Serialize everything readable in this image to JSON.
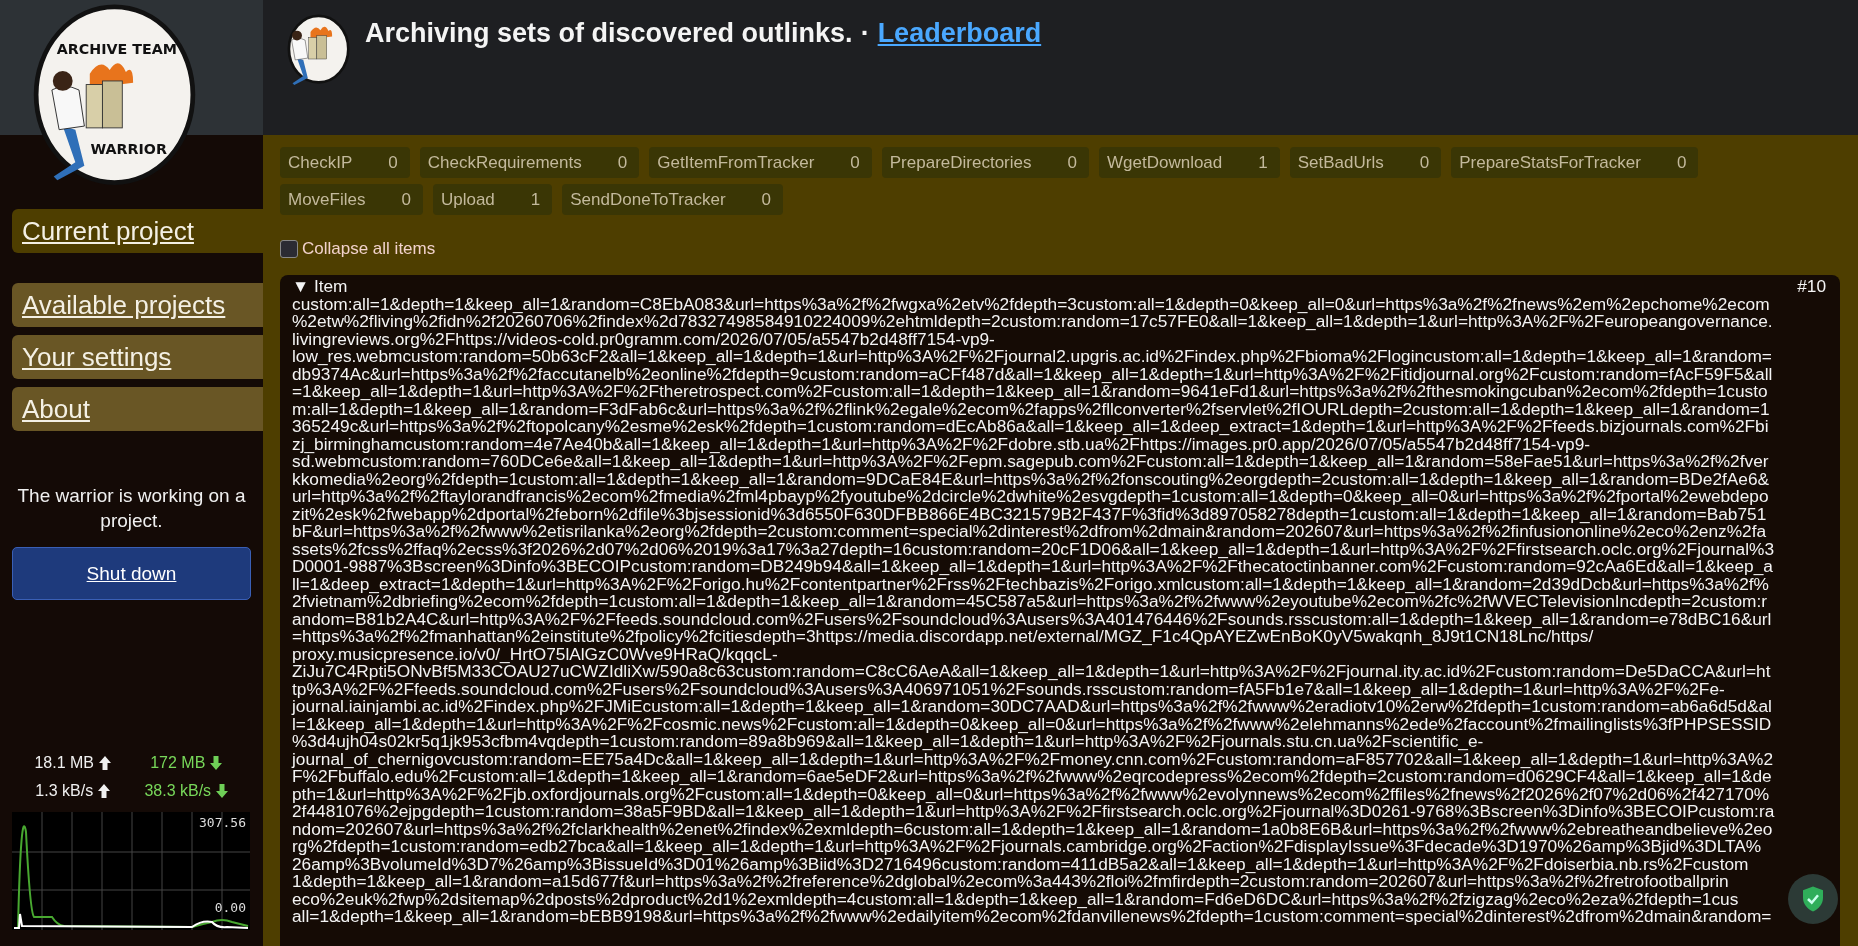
{
  "sidebar": {
    "logo_text": [
      "ARCHIVE TEAM",
      "WARRIOR"
    ],
    "nav": [
      {
        "label": "Current project",
        "selected": true
      },
      {
        "label": "Available projects",
        "selected": false
      },
      {
        "label": "Your settings",
        "selected": false
      },
      {
        "label": "About",
        "selected": false
      }
    ],
    "status": "The warrior is working on a project.",
    "shutdown_button": "Shut down",
    "stats": {
      "uploaded": "18.1 MB",
      "downloaded": "172 MB",
      "upload_rate": "1.3 kB/s",
      "download_rate": "38.3 kB/s"
    },
    "graph": {
      "max_label": "307.56",
      "min_label": "0.00"
    }
  },
  "header": {
    "title": "Archiving sets of discovered outlinks.",
    "separator": "·",
    "link": "Leaderboard"
  },
  "tasks": [
    {
      "name": "CheckIP",
      "count": "0"
    },
    {
      "name": "CheckRequirements",
      "count": "0"
    },
    {
      "name": "GetItemFromTracker",
      "count": "0"
    },
    {
      "name": "PrepareDirectories",
      "count": "0"
    },
    {
      "name": "WgetDownload",
      "count": "1"
    },
    {
      "name": "SetBadUrls",
      "count": "0"
    },
    {
      "name": "PrepareStatsForTracker",
      "count": "0"
    },
    {
      "name": "MoveFiles",
      "count": "0"
    },
    {
      "name": "Upload",
      "count": "1"
    },
    {
      "name": "SendDoneToTracker",
      "count": "0"
    }
  ],
  "collapse_all": {
    "label": "Collapse all items",
    "checked": false
  },
  "item": {
    "toggle": "▼",
    "title": "Item",
    "number": "#10",
    "lines": [
      "custom:all=1&depth=1&keep_all=1&random=C8EbA083&url=https%3a%2f%2fwgxa%2etv%2fdepth=3custom:all=1&depth=0&keep_all=0&url=https%3a%2f%2fnews%2em%2epchome%2ecom",
      "%2etw%2fliving%2fidn%2f20260706%2findex%2d78327498584910224009%2ehtmldepth=2custom:random=17c57FE0&all=1&keep_all=1&depth=1&url=http%3A%2F%2Feuropeangovernance.",
      "livingreviews.org%2Fhttps://videos-cold.pr0gramm.com/2026/07/05/a5547b2d48ff7154-vp9-",
      "low_res.webmcustom:random=50b63cF2&all=1&keep_all=1&depth=1&url=http%3A%2F%2Fjournal2.upgris.ac.id%2Findex.php%2Fbioma%2Flogincustom:all=1&depth=1&keep_all=1&random=",
      "db9374Ac&url=https%3a%2f%2faccutanelb%2eonline%2fdepth=9custom:random=aCFf487d&all=1&keep_all=1&depth=1&url=http%3A%2F%2Fitidjournal.org%2Fcustom:random=fAcF59F5&all",
      "=1&keep_all=1&depth=1&url=http%3A%2F%2Ftheretrospect.com%2Fcustom:all=1&depth=1&keep_all=1&random=9641eFd1&url=https%3a%2f%2fthesmokingcuban%2ecom%2fdepth=1custo",
      "m:all=1&depth=1&keep_all=1&random=F3dFab6c&url=https%3a%2f%2flink%2egale%2ecom%2fapps%2fllconverter%2fservlet%2fIOURLdepth=2custom:all=1&depth=1&keep_all=1&random=1",
      "365249c&url=https%3a%2f%2ftopolcany%2esme%2esk%2fdepth=1custom:random=dEcAb86a&all=1&keep_all=1&deep_extract=1&depth=1&url=http%3A%2F%2Ffeeds.bizjournals.com%2Fbi",
      "zj_birminghamcustom:random=4e7Ae40b&all=1&keep_all=1&depth=1&url=http%3A%2F%2Fdobre.stb.ua%2Fhttps://images.pr0.app/2026/07/05/a5547b2d48ff7154-vp9-",
      "sd.webmcustom:random=760DCe6e&all=1&keep_all=1&depth=1&url=http%3A%2F%2Fepm.sagepub.com%2Fcustom:all=1&depth=1&keep_all=1&random=58eFae51&url=https%3a%2f%2fver",
      "kkomedia%2eorg%2fdepth=1custom:all=1&depth=1&keep_all=1&random=9DCaE84E&url=https%3a%2f%2fonscouting%2eorgdepth=2custom:all=1&depth=1&keep_all=1&random=BDe2fAe6&",
      "url=http%3a%2f%2ftaylorandfrancis%2ecom%2fmedia%2fml4pbayp%2fyoutube%2dcircle%2dwhite%2esvgdepth=1custom:all=1&depth=0&keep_all=0&url=https%3a%2f%2fportal%2ewebdepo",
      "zit%2esk%2fwebapp%2dportal%2feborn%2dfile%3bjsessionid%3d6550F630DFBB866E4BC321579B2F437F%3fid%3d897058278depth=1custom:all=1&depth=1&keep_all=1&random=Bab751",
      "bF&url=https%3a%2f%2fwww%2etisrilanka%2eorg%2fdepth=2custom:comment=special%2dinterest%2dfrom%2dmain&random=202607&url=https%3a%2f%2finfusiononline%2eco%2enz%2fa",
      "ssets%2fcss%2ffaq%2ecss%3f2026%2d07%2d06%2019%3a17%3a27depth=16custom:random=20cF1D06&all=1&keep_all=1&depth=1&url=http%3A%2F%2Ffirstsearch.oclc.org%2Fjournal%3",
      "D0001-9887%3Bscreen%3Dinfo%3BECOIPcustom:random=DB249b94&all=1&keep_all=1&depth=1&url=http%3A%2F%2Fthecatoctinbanner.com%2Fcustom:random=92cAa6Ed&all=1&keep_a",
      "ll=1&deep_extract=1&depth=1&url=http%3A%2F%2Forigo.hu%2Fcontentpartner%2Frss%2Ftechbazis%2Forigo.xmlcustom:all=1&depth=1&keep_all=1&random=2d39dDcb&url=https%3a%2f%",
      "2fvietnam%2dbriefing%2ecom%2fdepth=1custom:all=1&depth=1&keep_all=1&random=45C587a5&url=https%3a%2f%2fwww%2eyoutube%2ecom%2fc%2fWVECTelevisionIncdepth=2custom:r",
      "andom=B81b2A4C&url=http%3A%2F%2Ffeeds.soundcloud.com%2Fusers%2Fsoundcloud%3Ausers%3A401476446%2Fsounds.rsscustom:all=1&depth=1&keep_all=1&random=e78dBC16&url",
      "=https%3a%2f%2fmanhattan%2einstitute%2fpolicy%2fcitiesdepth=3https://media.discordapp.net/external/MGZ_F1c4QpAYEZwEnBoK0yV5wakqnh_8J9t1CN18Lnc/https/",
      "proxy.musicpresence.io/v0/_HrtO75lAlGzC0Wve9HRaQ/kqqcL-",
      "ZiJu7C4Rpti5ONvBf5M33COAU27uCWZIdliXw/590a8c63custom:random=C8cC6AeA&all=1&keep_all=1&depth=1&url=http%3A%2F%2Fjournal.ity.ac.id%2Fcustom:random=De5DaCCA&url=ht",
      "tp%3A%2F%2Ffeeds.soundcloud.com%2Fusers%2Fsoundcloud%3Ausers%3A406971051%2Fsounds.rsscustom:random=fA5Fb1e7&all=1&keep_all=1&depth=1&url=http%3A%2F%2Fe-",
      "journal.iainjambi.ac.id%2Findex.php%2FJMiEcustom:all=1&depth=1&keep_all=1&random=30DC7AAD&url=https%3a%2f%2fwww%2eradiotv10%2erw%2fdepth=1custom:random=ab6a6d5d&al",
      "l=1&keep_all=1&depth=1&url=http%3A%2F%2Fcosmic.news%2Fcustom:all=1&depth=0&keep_all=0&url=https%3a%2f%2fwww%2elehmanns%2ede%2faccount%2fmailinglists%3fPHPSESSID",
      "%3d4ujh04s02kr5q1jk953cfbm4vqdepth=1custom:random=89a8b969&all=1&keep_all=1&depth=1&url=http%3A%2F%2Fjournals.stu.cn.ua%2Fscientific_e-",
      "journal_of_chernigovcustom:random=EE75a4Dc&all=1&keep_all=1&depth=1&url=http%3A%2F%2Fmoney.cnn.com%2Fcustom:random=aF857702&all=1&keep_all=1&depth=1&url=http%3A%2",
      "F%2Fbuffalo.edu%2Fcustom:all=1&depth=1&keep_all=1&random=6ae5eDF2&url=https%3a%2f%2fwww%2eqrcodepress%2ecom%2fdepth=2custom:random=d0629CF4&all=1&keep_all=1&de",
      "pth=1&url=http%3A%2F%2Fjb.oxfordjournals.org%2Fcustom:all=1&depth=0&keep_all=0&url=https%3a%2f%2fwww%2evolynnews%2ecom%2ffiles%2fnews%2f2026%2f07%2d06%2f427170%",
      "2f4481076%2ejpgdepth=1custom:random=38a5F9BD&all=1&keep_all=1&depth=1&url=http%3A%2F%2Ffirstsearch.oclc.org%2Fjournal%3D0261-9768%3Bscreen%3Dinfo%3BECOIPcustom:ra",
      "ndom=202607&url=https%3a%2f%2fclarkhealth%2enet%2findex%2exmldepth=6custom:all=1&depth=1&keep_all=1&random=1a0b8E6B&url=https%3a%2f%2fwww%2ebreatheandbelieve%2eo",
      "rg%2fdepth=1custom:random=edb27bca&all=1&keep_all=1&depth=1&url=http%3A%2F%2Fjournals.cambridge.org%2Faction%2FdisplayIssue%3Fdecade%3D1970%26amp%3Bjid%3DLTA%",
      "26amp%3BvolumeId%3D7%26amp%3BissueId%3D01%26amp%3Biid%3D2716496custom:random=411dB5a2&all=1&keep_all=1&depth=1&url=http%3A%2F%2Fdoiserbia.nb.rs%2Fcustom",
      "1&depth=1&keep_all=1&random=a15d677f&url=https%3a%2f%2freference%2dglobal%2ecom%3a443%2floi%2fmfirdepth=2custom:random=202607&url=https%3a%2f%2fretrofootballprin",
      "eco%2euk%2fwp%2dsitemap%2dposts%2dproduct%2d1%2exmldepth=4custom:all=1&depth=1&keep_all=1&random=Fd6eD6DC&url=https%3a%2f%2fzigzag%2eco%2eza%2fdepth=1cus",
      "all=1&depth=1&keep_all=1&random=bEBB9198&url=https%3a%2f%2fwww%2edailyitem%2ecom%2fdanvillenews%2fdepth=1custom:comment=special%2dinterest%2dfrom%2dmain&random="
    ]
  }
}
